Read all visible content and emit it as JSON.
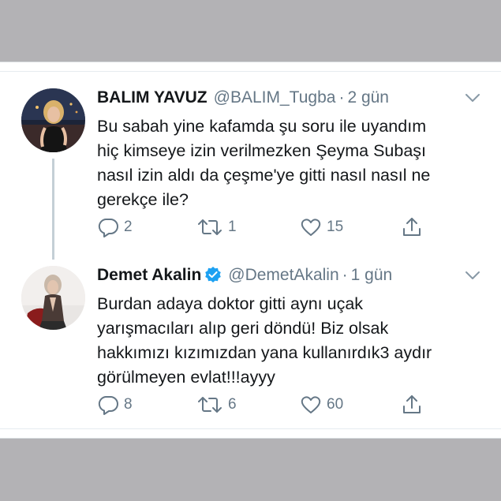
{
  "tweets": [
    {
      "display_name": "BALIM YAVUZ",
      "verified": false,
      "handle": "@BALIM_Tugba",
      "separator": "·",
      "time": "2 gün",
      "text": "Bu sabah yine kafamda şu soru ile uyandım\nhiç kimseye izin verilmezken Şeyma Subaşı\nnasıl izin aldı da çeşme'ye gitti nasıl nasıl ne\ngerekçe ile?",
      "replies": "2",
      "retweets": "1",
      "likes": "15"
    },
    {
      "display_name": "Demet Akalin",
      "verified": true,
      "handle": "@DemetAkalin",
      "separator": "·",
      "time": "1 gün",
      "text": "Burdan adaya doktor gitti aynı uçak\nyarışmacıları alıp geri döndü! Biz olsak\nhakkımızı kızımızdan yana kullanırdık3 aydır\ngörülmeyen evlat!!!ayyy",
      "replies": "8",
      "retweets": "6",
      "likes": "60"
    }
  ],
  "icons": {
    "reply": "reply-icon",
    "retweet": "retweet-icon",
    "like": "heart-icon",
    "share": "share-icon",
    "more": "chevron-down-icon",
    "verified": "verified-badge-icon"
  },
  "colors": {
    "background": "#b3b2b5",
    "text": "#14171a",
    "secondary": "#657786",
    "verified": "#1da1f2",
    "thread_line": "#c4cfd6"
  }
}
